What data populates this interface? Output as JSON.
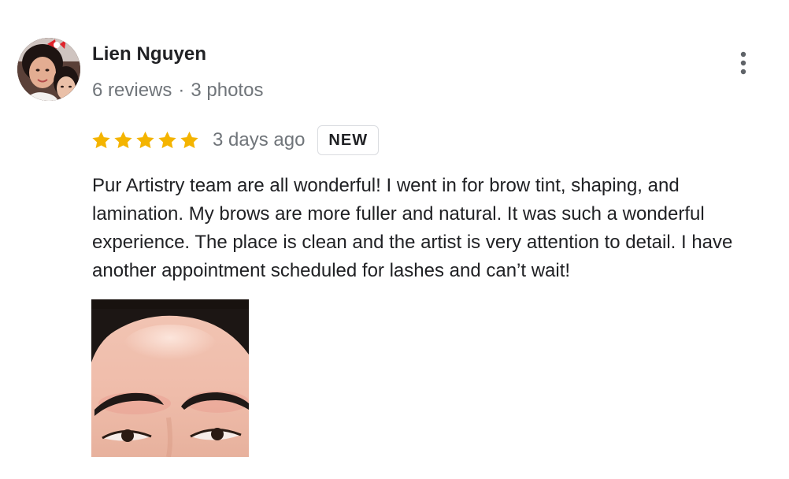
{
  "reviewer": {
    "name": "Lien Nguyen",
    "reviews": "6 reviews",
    "separator": "·",
    "photos": "3 photos",
    "avatar_icon": "user-avatar"
  },
  "rating": {
    "stars": 5,
    "max_stars": 5,
    "star_color": "#f4b400",
    "date": "3 days ago",
    "badge": "NEW"
  },
  "review": {
    "text_lines": [
      "Pur Artistry team are all wonderful! I went in for brow tint, shaping, and",
      "lamination. My brows are more fuller and natural. It was such a wonderful",
      "experience. The place is clean and the artist is very attention to detail. I have",
      "another appointment scheduled for lashes and can’t wait!"
    ]
  },
  "actions": {
    "more_icon": "more-vert-icon"
  },
  "photo": {
    "icon": "review-photo"
  }
}
